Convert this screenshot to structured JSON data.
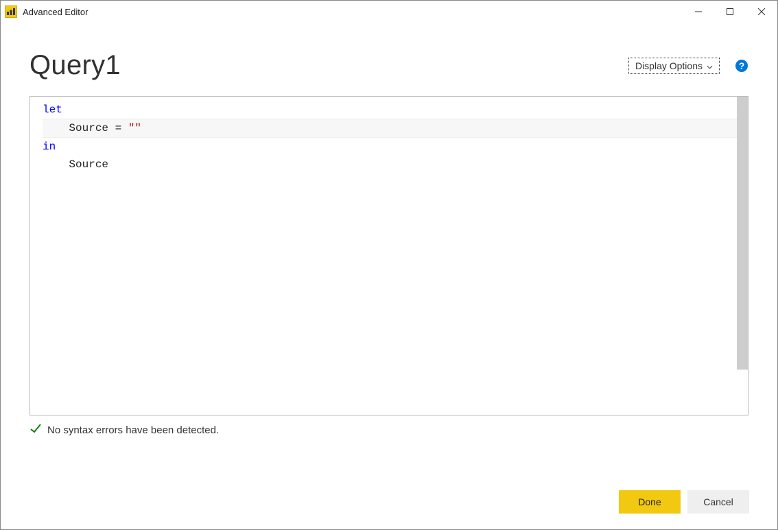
{
  "window": {
    "title": "Advanced Editor"
  },
  "header": {
    "query_name": "Query1",
    "display_options_label": "Display Options"
  },
  "editor": {
    "line1_keyword": "let",
    "line2_prefix": "    Source = ",
    "line2_string": "\"\"",
    "line3_keyword": "in",
    "line4": "    Source"
  },
  "status": {
    "message": "No syntax errors have been detected."
  },
  "footer": {
    "done_label": "Done",
    "cancel_label": "Cancel"
  }
}
